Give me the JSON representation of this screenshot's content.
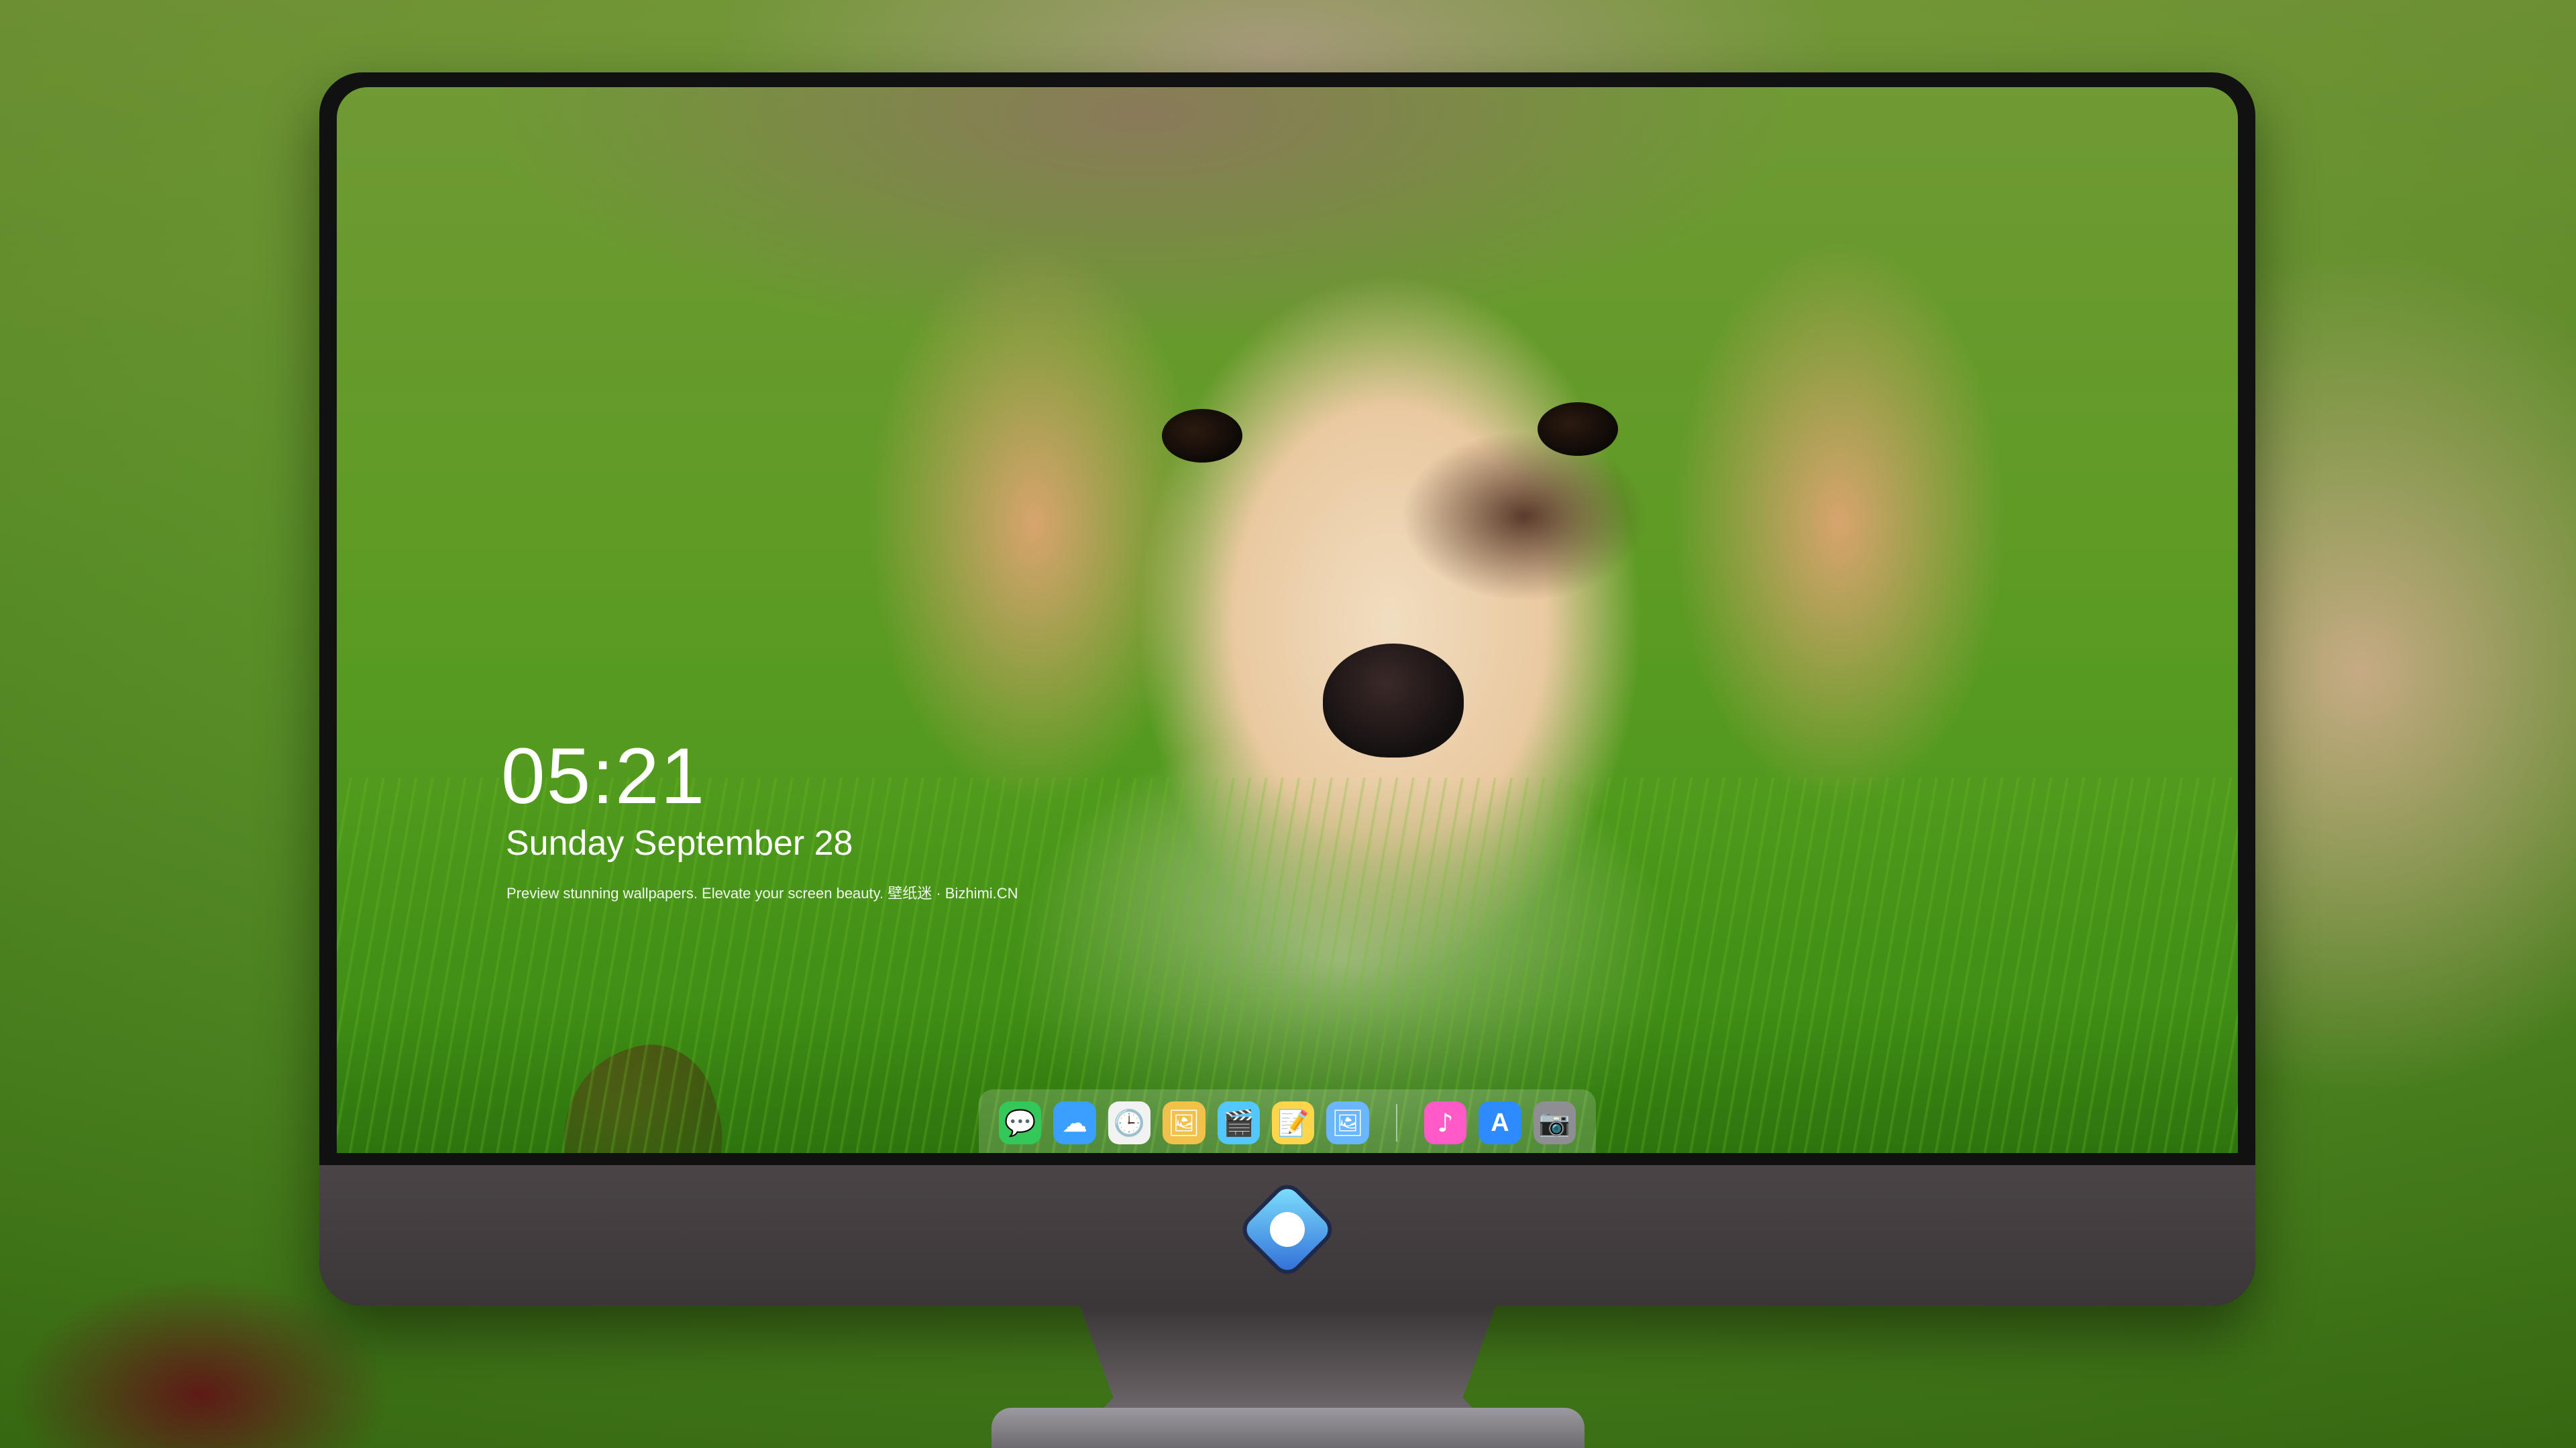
{
  "lockscreen": {
    "time": "05:21",
    "date": "Sunday September  28",
    "tagline": "Preview stunning wallpapers. Elevate your screen beauty. 壁纸迷 · Bizhimi.CN"
  },
  "dock": {
    "apps": [
      {
        "name": "messages",
        "glyph": "💬",
        "color": "#34c759"
      },
      {
        "name": "weather",
        "glyph": "☁",
        "color": "#3aa0ff"
      },
      {
        "name": "clock",
        "glyph": "🕒",
        "color": "#f2f2f2"
      },
      {
        "name": "preview",
        "glyph": "🖼",
        "color": "#f0c24b"
      },
      {
        "name": "clips",
        "glyph": "🎬",
        "color": "#53c7ff"
      },
      {
        "name": "notes",
        "glyph": "📝",
        "color": "#ffd54a"
      },
      {
        "name": "photos",
        "glyph": "🖼",
        "color": "#6ab7ff"
      },
      {
        "name": "music",
        "glyph": "♪",
        "color": "#ff5ac8"
      },
      {
        "name": "app-store",
        "glyph": "A",
        "color": "#2e8bff"
      },
      {
        "name": "camera",
        "glyph": "📷",
        "color": "#8e8e93"
      }
    ]
  }
}
